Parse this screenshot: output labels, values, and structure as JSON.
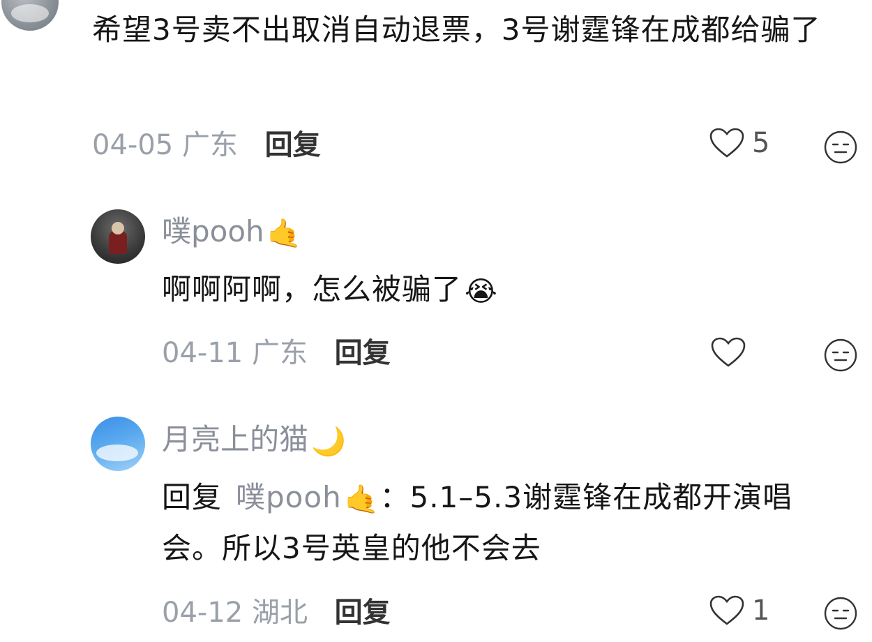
{
  "comments": [
    {
      "text": "希望3号卖不出取消自动退票，3号谢霆锋在成都给骗了",
      "date": "04-05",
      "location": "广东",
      "reply_label": "回复",
      "likes": "5"
    },
    {
      "username": "噗pooh",
      "username_emoji": "🤙",
      "text": "啊啊阿啊，怎么被骗了",
      "text_emoji": "😭",
      "date": "04-11",
      "location": "广东",
      "reply_label": "回复",
      "likes": ""
    },
    {
      "username": "月亮上的猫",
      "username_emoji": "🌙",
      "reply_prefix": "回复",
      "reply_to": "噗pooh",
      "reply_to_emoji": "🤙",
      "text": "：5.1–5.3谢霆锋在成都开演唱会。所以3号英皇的他不会去",
      "date": "04-12",
      "location": "湖北",
      "reply_label": "回复",
      "likes": "1"
    }
  ],
  "icons": {
    "like": "heart-outline-icon",
    "reaction": "neutral-face-icon"
  },
  "colors": {
    "text": "#161616",
    "meta": "#9aa0aa",
    "username": "#8a8f9a"
  }
}
